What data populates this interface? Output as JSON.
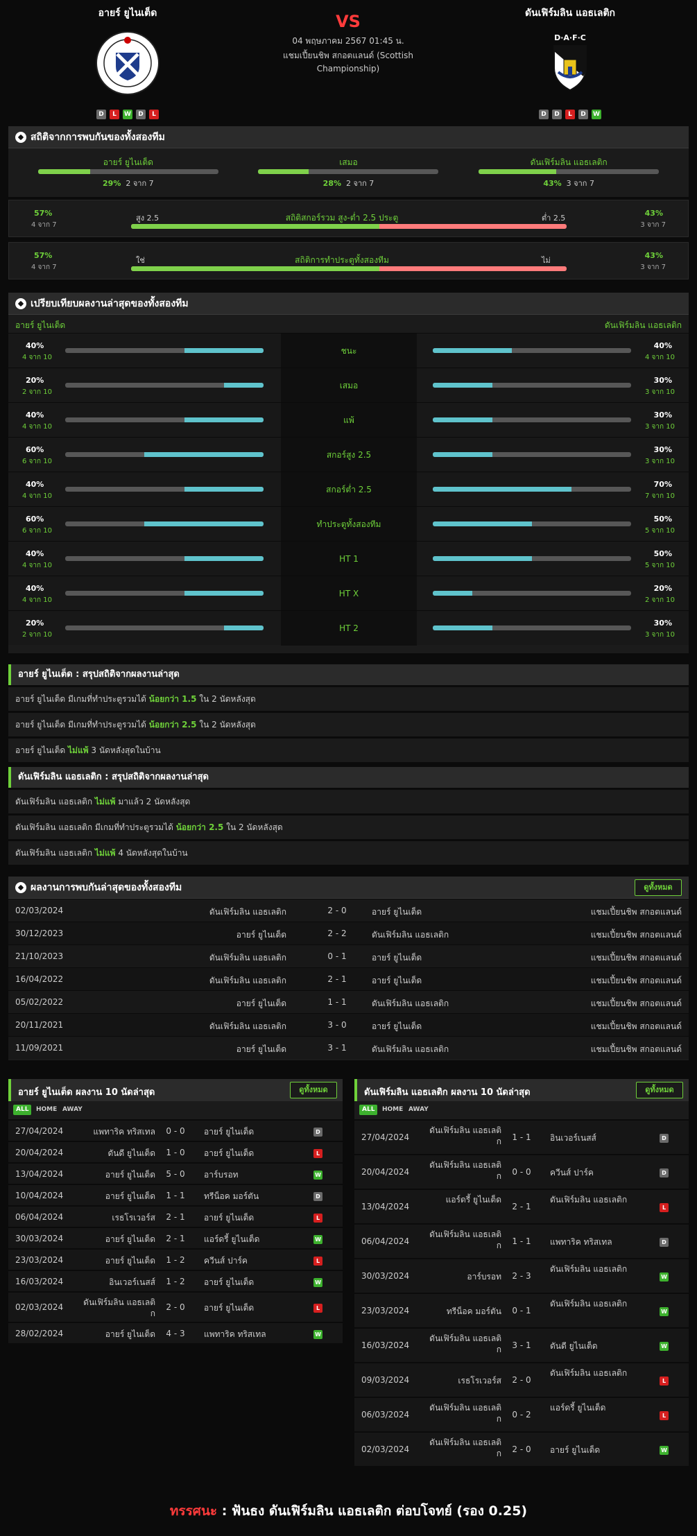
{
  "header": {
    "home_team": "อายร์ ยูไนเต็ด",
    "away_team": "ดันเฟิร์มลิน แอธเลติก",
    "vs": "VS",
    "date_line": "04 พฤษภาคม 2567 01:45 น.",
    "league_line": "แชมเปี้ยนชิพ สกอตแลนด์ (Scottish Championship)",
    "home_form": [
      "D",
      "L",
      "W",
      "D",
      "L"
    ],
    "away_form": [
      "D",
      "D",
      "L",
      "D",
      "W"
    ],
    "home_logo_text": "AYR UNITED FOOTBALL CLUB",
    "away_logo_text": "D·A·F·C"
  },
  "h2h": {
    "title": "สถิติจากการพบกันของทั้งสองทีม",
    "items": [
      {
        "label": "อายร์ ยูไนเต็ด",
        "pct": "29%",
        "count": "2 จาก 7",
        "value": 0.29
      },
      {
        "label": "เสมอ",
        "pct": "28%",
        "count": "2 จาก 7",
        "value": 0.28
      },
      {
        "label": "ดันเฟิร์มลิน แอธเลติก",
        "pct": "43%",
        "count": "3 จาก 7",
        "value": 0.43
      }
    ]
  },
  "ou": {
    "left_pct": "57%",
    "left_count": "4 จาก 7",
    "left_label": "สูง 2.5",
    "title": "สถิติสกอร์รวม สูง-ต่ำ 2.5 ประตู",
    "right_label": "ต่ำ 2.5",
    "right_pct": "43%",
    "right_count": "3 จาก 7",
    "value": 0.57
  },
  "btts": {
    "left_pct": "57%",
    "left_count": "4 จาก 7",
    "left_label": "ใช่",
    "title": "สถิติการทำประตูทั้งสองทีม",
    "right_label": "ไม่",
    "right_pct": "43%",
    "right_count": "3 จาก 7",
    "value": 0.57
  },
  "compare": {
    "title": "เปรียบเทียบผลงานล่าสุดของทั้งสองทีม",
    "home": "อายร์ ยูไนเต็ด",
    "away": "ดันเฟิร์มลิน แอธเลติก",
    "rows": [
      {
        "label": "ชนะ",
        "lp": "40%",
        "lc": "4 จาก 10",
        "lv": 0.4,
        "rp": "40%",
        "rc": "4 จาก 10",
        "rv": 0.4
      },
      {
        "label": "เสมอ",
        "lp": "20%",
        "lc": "2 จาก 10",
        "lv": 0.2,
        "rp": "30%",
        "rc": "3 จาก 10",
        "rv": 0.3
      },
      {
        "label": "แพ้",
        "lp": "40%",
        "lc": "4 จาก 10",
        "lv": 0.4,
        "rp": "30%",
        "rc": "3 จาก 10",
        "rv": 0.3
      },
      {
        "label": "สกอร์สูง 2.5",
        "lp": "60%",
        "lc": "6 จาก 10",
        "lv": 0.6,
        "rp": "30%",
        "rc": "3 จาก 10",
        "rv": 0.3
      },
      {
        "label": "สกอร์ต่ำ 2.5",
        "lp": "40%",
        "lc": "4 จาก 10",
        "lv": 0.4,
        "rp": "70%",
        "rc": "7 จาก 10",
        "rv": 0.7
      },
      {
        "label": "ทำประตูทั้งสองทีม",
        "lp": "60%",
        "lc": "6 จาก 10",
        "lv": 0.6,
        "rp": "50%",
        "rc": "5 จาก 10",
        "rv": 0.5
      },
      {
        "label": "HT 1",
        "lp": "40%",
        "lc": "4 จาก 10",
        "lv": 0.4,
        "rp": "50%",
        "rc": "5 จาก 10",
        "rv": 0.5
      },
      {
        "label": "HT X",
        "lp": "40%",
        "lc": "4 จาก 10",
        "lv": 0.4,
        "rp": "20%",
        "rc": "2 จาก 10",
        "rv": 0.2
      },
      {
        "label": "HT 2",
        "lp": "20%",
        "lc": "2 จาก 10",
        "lv": 0.2,
        "rp": "30%",
        "rc": "3 จาก 10",
        "rv": 0.3
      }
    ]
  },
  "home_summary": {
    "title": "อายร์ ยูไนเต็ด : สรุปสถิติจากผลงานล่าสุด",
    "lines": [
      {
        "a": "อายร์ ยูไนเต็ด  มีเกมที่ทำประตูรวมได้ ",
        "h": "น้อยกว่า 1.5",
        "b": " ใน 2 นัดหลังสุด"
      },
      {
        "a": "อายร์ ยูไนเต็ด  มีเกมที่ทำประตูรวมได้ ",
        "h": "น้อยกว่า 2.5",
        "b": " ใน 2 นัดหลังสุด"
      },
      {
        "a": "อายร์ ยูไนเต็ด ",
        "h": "ไม่แพ้",
        "b": " 3 นัดหลังสุดในบ้าน"
      }
    ]
  },
  "away_summary": {
    "title": "ดันเฟิร์มลิน แอธเลติก : สรุปสถิติจากผลงานล่าสุด",
    "lines": [
      {
        "a": "ดันเฟิร์มลิน แอธเลติก ",
        "h": "ไม่แพ้",
        "b": " มาแล้ว 2 นัดหลังสุด"
      },
      {
        "a": "ดันเฟิร์มลิน แอธเลติก  มีเกมที่ทำประตูรวมได้ ",
        "h": "น้อยกว่า 2.5",
        "b": " ใน 2 นัดหลังสุด"
      },
      {
        "a": "ดันเฟิร์มลิน แอธเลติก ",
        "h": "ไม่แพ้",
        "b": " 4 นัดหลังสุดในบ้าน"
      }
    ]
  },
  "results": {
    "title": "ผลงานการพบกันล่าสุดของทั้งสองทีม",
    "view_all": "ดูทั้งหมด",
    "rows": [
      {
        "date": "02/03/2024",
        "home": "ดันเฟิร์มลิน แอธเลติก",
        "score": "2 - 0",
        "away": "อายร์ ยูไนเต็ด",
        "league": "แชมเปี้ยนชิพ สกอตแลนด์"
      },
      {
        "date": "30/12/2023",
        "home": "อายร์ ยูไนเต็ด",
        "score": "2 - 2",
        "away": "ดันเฟิร์มลิน แอธเลติก",
        "league": "แชมเปี้ยนชิพ สกอตแลนด์"
      },
      {
        "date": "21/10/2023",
        "home": "ดันเฟิร์มลิน แอธเลติก",
        "score": "0 - 1",
        "away": "อายร์ ยูไนเต็ด",
        "league": "แชมเปี้ยนชิพ สกอตแลนด์"
      },
      {
        "date": "16/04/2022",
        "home": "ดันเฟิร์มลิน แอธเลติก",
        "score": "2 - 1",
        "away": "อายร์ ยูไนเต็ด",
        "league": "แชมเปี้ยนชิพ สกอตแลนด์"
      },
      {
        "date": "05/02/2022",
        "home": "อายร์ ยูไนเต็ด",
        "score": "1 - 1",
        "away": "ดันเฟิร์มลิน แอธเลติก",
        "league": "แชมเปี้ยนชิพ สกอตแลนด์"
      },
      {
        "date": "20/11/2021",
        "home": "ดันเฟิร์มลิน แอธเลติก",
        "score": "3 - 0",
        "away": "อายร์ ยูไนเต็ด",
        "league": "แชมเปี้ยนชิพ สกอตแลนด์"
      },
      {
        "date": "11/09/2021",
        "home": "อายร์ ยูไนเต็ด",
        "score": "3 - 1",
        "away": "ดันเฟิร์มลิน แอธเลติก",
        "league": "แชมเปี้ยนชิพ สกอตแลนด์"
      }
    ]
  },
  "home_last10": {
    "title": "อายร์ ยูไนเต็ด ผลงาน 10 นัดล่าสุด",
    "view_all": "ดูทั้งหมด",
    "tabs": [
      "ALL",
      "HOME",
      "AWAY"
    ],
    "rows": [
      {
        "date": "27/04/2024",
        "home": "แพทาริค ทริสเทล",
        "score": "0 - 0",
        "away": "อายร์ ยูไนเต็ด",
        "r": "D"
      },
      {
        "date": "20/04/2024",
        "home": "ดันดี ยูไนเต็ด",
        "score": "1 - 0",
        "away": "อายร์ ยูไนเต็ด",
        "r": "L"
      },
      {
        "date": "13/04/2024",
        "home": "อายร์ ยูไนเต็ด",
        "score": "5 - 0",
        "away": "อาร์บรอท",
        "r": "W"
      },
      {
        "date": "10/04/2024",
        "home": "อายร์ ยูไนเต็ด",
        "score": "1 - 1",
        "away": "ทรีน็อค มอร์ตัน",
        "r": "D"
      },
      {
        "date": "06/04/2024",
        "home": "เรธโรเวอร์ส",
        "score": "2 - 1",
        "away": "อายร์ ยูไนเต็ด",
        "r": "L"
      },
      {
        "date": "30/03/2024",
        "home": "อายร์ ยูไนเต็ด",
        "score": "2 - 1",
        "away": "แอร์ดรี้ ยูไนเต็ด",
        "r": "W"
      },
      {
        "date": "23/03/2024",
        "home": "อายร์ ยูไนเต็ด",
        "score": "1 - 2",
        "away": "ควีนส์ ปาร์ค",
        "r": "L"
      },
      {
        "date": "16/03/2024",
        "home": "อินเวอร์เนสส์",
        "score": "1 - 2",
        "away": "อายร์ ยูไนเต็ด",
        "r": "W"
      },
      {
        "date": "02/03/2024",
        "home": "ดันเฟิร์มลิน แอธเลติก",
        "score": "2 - 0",
        "away": "อายร์ ยูไนเต็ด",
        "r": "L"
      },
      {
        "date": "28/02/2024",
        "home": "อายร์ ยูไนเต็ด",
        "score": "4 - 3",
        "away": "แพทาริค ทริสเทล",
        "r": "W"
      }
    ]
  },
  "away_last10": {
    "title": "ดันเฟิร์มลิน แอธเลติก ผลงาน 10 นัดล่าสุด",
    "view_all": "ดูทั้งหมด",
    "tabs": [
      "ALL",
      "HOME",
      "AWAY"
    ],
    "rows": [
      {
        "date": "27/04/2024",
        "home": "ดันเฟิร์มลิน แอธเลติก",
        "score": "1 - 1",
        "away": "อินเวอร์เนสส์",
        "r": "D"
      },
      {
        "date": "20/04/2024",
        "home": "ดันเฟิร์มลิน แอธเลติก",
        "score": "0 - 0",
        "away": "ควีนส์ ปาร์ค",
        "r": "D"
      },
      {
        "date": "13/04/2024",
        "home": "แอร์ดรี้ ยูไนเต็ด",
        "score": "2 - 1",
        "away": "ดันเฟิร์มลิน แอธเลติก",
        "r": "L"
      },
      {
        "date": "06/04/2024",
        "home": "ดันเฟิร์มลิน แอธเลติก",
        "score": "1 - 1",
        "away": "แพทาริค ทริสเทล",
        "r": "D"
      },
      {
        "date": "30/03/2024",
        "home": "อาร์บรอท",
        "score": "2 - 3",
        "away": "ดันเฟิร์มลิน แอธเลติก",
        "r": "W"
      },
      {
        "date": "23/03/2024",
        "home": "ทรีน็อค มอร์ตัน",
        "score": "0 - 1",
        "away": "ดันเฟิร์มลิน แอธเลติก",
        "r": "W"
      },
      {
        "date": "16/03/2024",
        "home": "ดันเฟิร์มลิน แอธเลติก",
        "score": "3 - 1",
        "away": "ดันดี ยูไนเต็ด",
        "r": "W"
      },
      {
        "date": "09/03/2024",
        "home": "เรธโรเวอร์ส",
        "score": "2 - 0",
        "away": "ดันเฟิร์มลิน แอธเลติก",
        "r": "L"
      },
      {
        "date": "06/03/2024",
        "home": "ดันเฟิร์มลิน แอธเลติก",
        "score": "0 - 2",
        "away": "แอร์ดรี้ ยูไนเต็ด",
        "r": "L"
      },
      {
        "date": "02/03/2024",
        "home": "ดันเฟิร์มลิน แอธเลติก",
        "score": "2 - 0",
        "away": "อายร์ ยูไนเต็ด",
        "r": "W"
      }
    ]
  },
  "footer": {
    "label": "ทรรศนะ",
    "sep": " : ",
    "text": "ฟันธง ดันเฟิร์มลิน แอธเลติก ต่อบโจทย์ (รอง 0.25)"
  },
  "colors": {
    "green": "#6fd13a",
    "teal": "#5fc3cc",
    "red": "#ff3b3b",
    "win": "#3db12e",
    "loss": "#d61f1f",
    "draw": "#6b6b6b"
  }
}
